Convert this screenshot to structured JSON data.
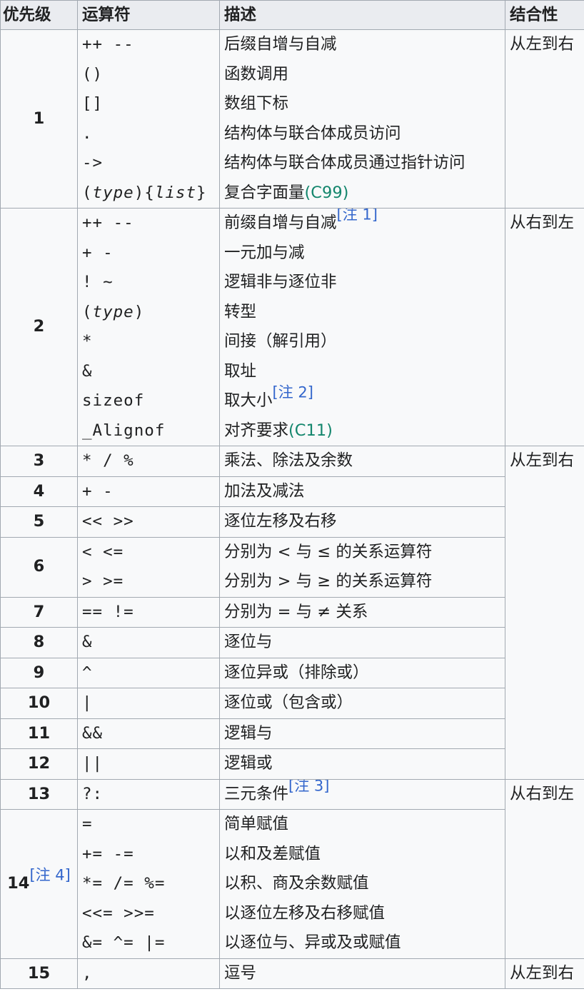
{
  "header": {
    "precedence": "优先级",
    "operator": "运算符",
    "description": "描述",
    "associativity": "结合性"
  },
  "rows": [
    {
      "precedence": "1",
      "operators": [
        "++ --",
        "()",
        "[]",
        ".",
        "->",
        "(type){list}"
      ],
      "descriptions": [
        "后缀自增与自减",
        "函数调用",
        "数组下标",
        "结构体与联合体成员访问",
        "结构体与联合体成员通过指针访问",
        "复合字面量"
      ],
      "standard": "(C99)",
      "associativity": "从左到右"
    },
    {
      "precedence": "2",
      "operators": [
        "++ --",
        "+ -",
        "! ~",
        "(type)",
        "*",
        "&",
        "sizeof",
        "_Alignof"
      ],
      "descriptions": [
        "前缀自增与自减",
        "一元加与减",
        "逻辑非与逐位非",
        "转型",
        "间接（解引用）",
        "取址",
        "取大小",
        "对齐要求"
      ],
      "note1": "[注 1]",
      "note2": "[注 2]",
      "standard": "(C11)",
      "associativity": "从右到左"
    },
    {
      "precedence": "3",
      "operator": "* / %",
      "description": "乘法、除法及余数",
      "associativity": "从左到右"
    },
    {
      "precedence": "4",
      "operator": "+ -",
      "description": "加法及减法"
    },
    {
      "precedence": "5",
      "operator": "<< >>",
      "description": "逐位左移及右移"
    },
    {
      "precedence": "6",
      "operators": [
        "< <=",
        "> >="
      ],
      "descriptions": [
        "分别为 < 与 ≤ 的关系运算符",
        "分别为 > 与 ≥ 的关系运算符"
      ]
    },
    {
      "precedence": "7",
      "operator": "== !=",
      "description": "分别为 = 与 ≠ 关系"
    },
    {
      "precedence": "8",
      "operator": "&",
      "description": "逐位与"
    },
    {
      "precedence": "9",
      "operator": "^",
      "description": "逐位异或（排除或）"
    },
    {
      "precedence": "10",
      "operator": "|",
      "description": "逐位或（包含或）"
    },
    {
      "precedence": "11",
      "operator": "&&",
      "description": "逻辑与"
    },
    {
      "precedence": "12",
      "operator": "||",
      "description": "逻辑或"
    },
    {
      "precedence": "13",
      "operator": "?:",
      "description": "三元条件",
      "note": "[注 3]",
      "associativity": "从右到左"
    },
    {
      "precedence": "14",
      "note": "[注 4]",
      "operators": [
        "=",
        "+= -=",
        "*= /= %=",
        "<<= >>=",
        "&= ^= |="
      ],
      "descriptions": [
        "简单赋值",
        "以和及差赋值",
        "以积、商及余数赋值",
        "以逐位左移及右移赋值",
        "以逐位与、异或及或赋值"
      ]
    },
    {
      "precedence": "15",
      "operator": ",",
      "description": "逗号",
      "associativity": "从左到右"
    }
  ]
}
